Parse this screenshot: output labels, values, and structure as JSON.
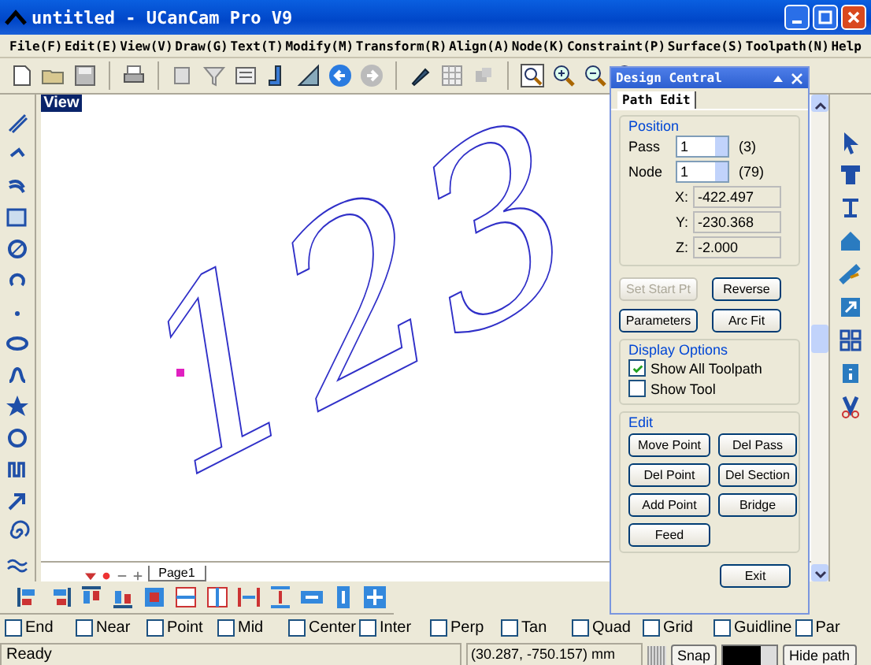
{
  "window": {
    "title": "untitled - UCanCam Pro V9"
  },
  "menu": [
    "File(F)",
    "Edit(E)",
    "View(V)",
    "Draw(G)",
    "Text(T)",
    "Modify(M)",
    "Transform(R)",
    "Align(A)",
    "Node(K)",
    "Constraint(P)",
    "Surface(S)",
    "Toolpath(N)",
    "Help"
  ],
  "canvas": {
    "view_label": "View",
    "artwork_text": "123"
  },
  "page_tabs": [
    {
      "label": "Page1",
      "selected": true
    }
  ],
  "design_central": {
    "title": "Design Central",
    "tabs": [
      {
        "label": "Path Edit",
        "selected": true
      }
    ],
    "position": {
      "title": "Position",
      "spinners": [
        {
          "label": "Pass",
          "value": "1",
          "count": "(3)"
        },
        {
          "label": "Node",
          "value": "1",
          "count": "(79)"
        }
      ],
      "coords": [
        {
          "label": "X:",
          "value": "-422.497"
        },
        {
          "label": "Y:",
          "value": "-230.368"
        },
        {
          "label": "Z:",
          "value": "-2.000"
        }
      ]
    },
    "actions": [
      {
        "label": "Set Start Pt",
        "disabled": true
      },
      {
        "label": "Reverse",
        "disabled": false
      },
      {
        "label": "Parameters",
        "disabled": false
      },
      {
        "label": "Arc Fit",
        "disabled": false
      }
    ],
    "display_options": {
      "title": "Display Options",
      "items": [
        {
          "label": "Show All Toolpath",
          "checked": true
        },
        {
          "label": "Show Tool",
          "checked": false
        }
      ]
    },
    "edit": {
      "title": "Edit",
      "buttons": [
        "Move Point",
        "Del Pass",
        "Del Point",
        "Del Section",
        "Add Point",
        "Bridge",
        "Feed"
      ]
    },
    "exit": "Exit"
  },
  "snap_options": [
    {
      "label": "End",
      "checked": false
    },
    {
      "label": "Near",
      "checked": false
    },
    {
      "label": "Point",
      "checked": false
    },
    {
      "label": "Mid",
      "checked": false
    },
    {
      "label": "Center",
      "checked": false
    },
    {
      "label": "Inter",
      "checked": false
    },
    {
      "label": "Perp",
      "checked": false
    },
    {
      "label": "Tan",
      "checked": false
    },
    {
      "label": "Quad",
      "checked": false
    },
    {
      "label": "Grid",
      "checked": false
    },
    {
      "label": "Guidline",
      "checked": false
    },
    {
      "label": "Par",
      "checked": false
    }
  ],
  "status_bar": {
    "text": "Ready",
    "coordinates": "(30.287, -750.157) mm",
    "snap": "Snap",
    "hide_path": "Hide path"
  }
}
